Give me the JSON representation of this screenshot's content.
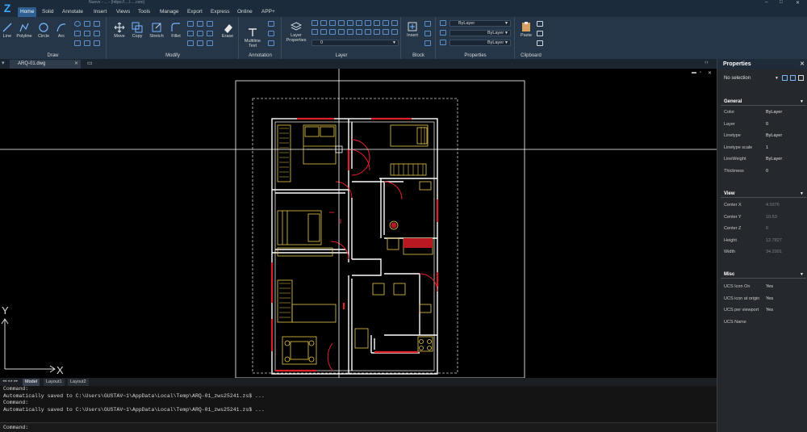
{
  "app": {
    "title": "Nuevo - ... - (https://..../.....com)",
    "menu_tabs": [
      "Home",
      "Solid",
      "Annotate",
      "Insert",
      "Views",
      "Tools",
      "Manage",
      "Export",
      "Express",
      "Online",
      "APP+"
    ],
    "active_tab": "Home"
  },
  "ribbon": {
    "draw": {
      "title": "Draw",
      "tools": [
        "Line",
        "Polyline",
        "Circle",
        "Arc"
      ]
    },
    "modify": {
      "title": "Modify",
      "tools": [
        "Move",
        "Copy",
        "Stretch",
        "Fillet",
        "Erase"
      ]
    },
    "annotation": {
      "title": "Annotation",
      "mtext": "Multiline Text"
    },
    "layer": {
      "title": "Layer",
      "props_label": "Layer Properties",
      "current_layer": "0"
    },
    "block": {
      "title": "Block",
      "insert_label": "Insert"
    },
    "properties": {
      "title": "Properties",
      "color": "ByLayer",
      "linetype": "ByLayer",
      "lineweight": "ByLayer"
    },
    "clipboard": {
      "title": "Clipboard",
      "paste_label": "Paste"
    }
  },
  "document": {
    "tab_name": "ARQ-01.dwg"
  },
  "canvas": {
    "axis_x": "X",
    "axis_y": "Y",
    "colors": {
      "wall": "#ffffff",
      "furniture": "#e8c84a",
      "door": "#e0202a",
      "crosshair": "#ffffff"
    }
  },
  "layout_tabs": [
    "Model",
    "Layout1",
    "Layout2"
  ],
  "active_layout": "Model",
  "command": {
    "lines": [
      "Command:",
      "Automatically saved to C:\\Users\\GUSTAV~1\\AppData\\Local\\Temp\\ARQ-01_zws25241.zs$ ...",
      "Command:",
      "Automatically saved to C:\\Users\\GUSTAV~1\\AppData\\Local\\Temp\\ARQ-01_zws25241.zs$ ..."
    ],
    "prompt": "Command:"
  },
  "properties": {
    "header": "Properties",
    "selection": "No selection",
    "general": {
      "title": "General",
      "rows": [
        {
          "k": "Color",
          "v": "ByLayer"
        },
        {
          "k": "Layer",
          "v": "0"
        },
        {
          "k": "Linetype",
          "v": "ByLayer"
        },
        {
          "k": "Linetype scale",
          "v": "1"
        },
        {
          "k": "LineWeight",
          "v": "ByLayer"
        },
        {
          "k": "Thickness",
          "v": "0"
        }
      ]
    },
    "view": {
      "title": "View",
      "rows": [
        {
          "k": "Center X",
          "v": "4.9376"
        },
        {
          "k": "Center Y",
          "v": "10.53"
        },
        {
          "k": "Center Z",
          "v": "0"
        },
        {
          "k": "Height",
          "v": "12.7827"
        },
        {
          "k": "Width",
          "v": "34.2001"
        }
      ]
    },
    "misc": {
      "title": "Misc",
      "rows": [
        {
          "k": "UCS Icon On",
          "v": "Yes"
        },
        {
          "k": "UCS icon at origin",
          "v": "Yes"
        },
        {
          "k": "UCS per viewport",
          "v": "Yes"
        },
        {
          "k": "UCS Name",
          "v": ""
        }
      ]
    }
  }
}
